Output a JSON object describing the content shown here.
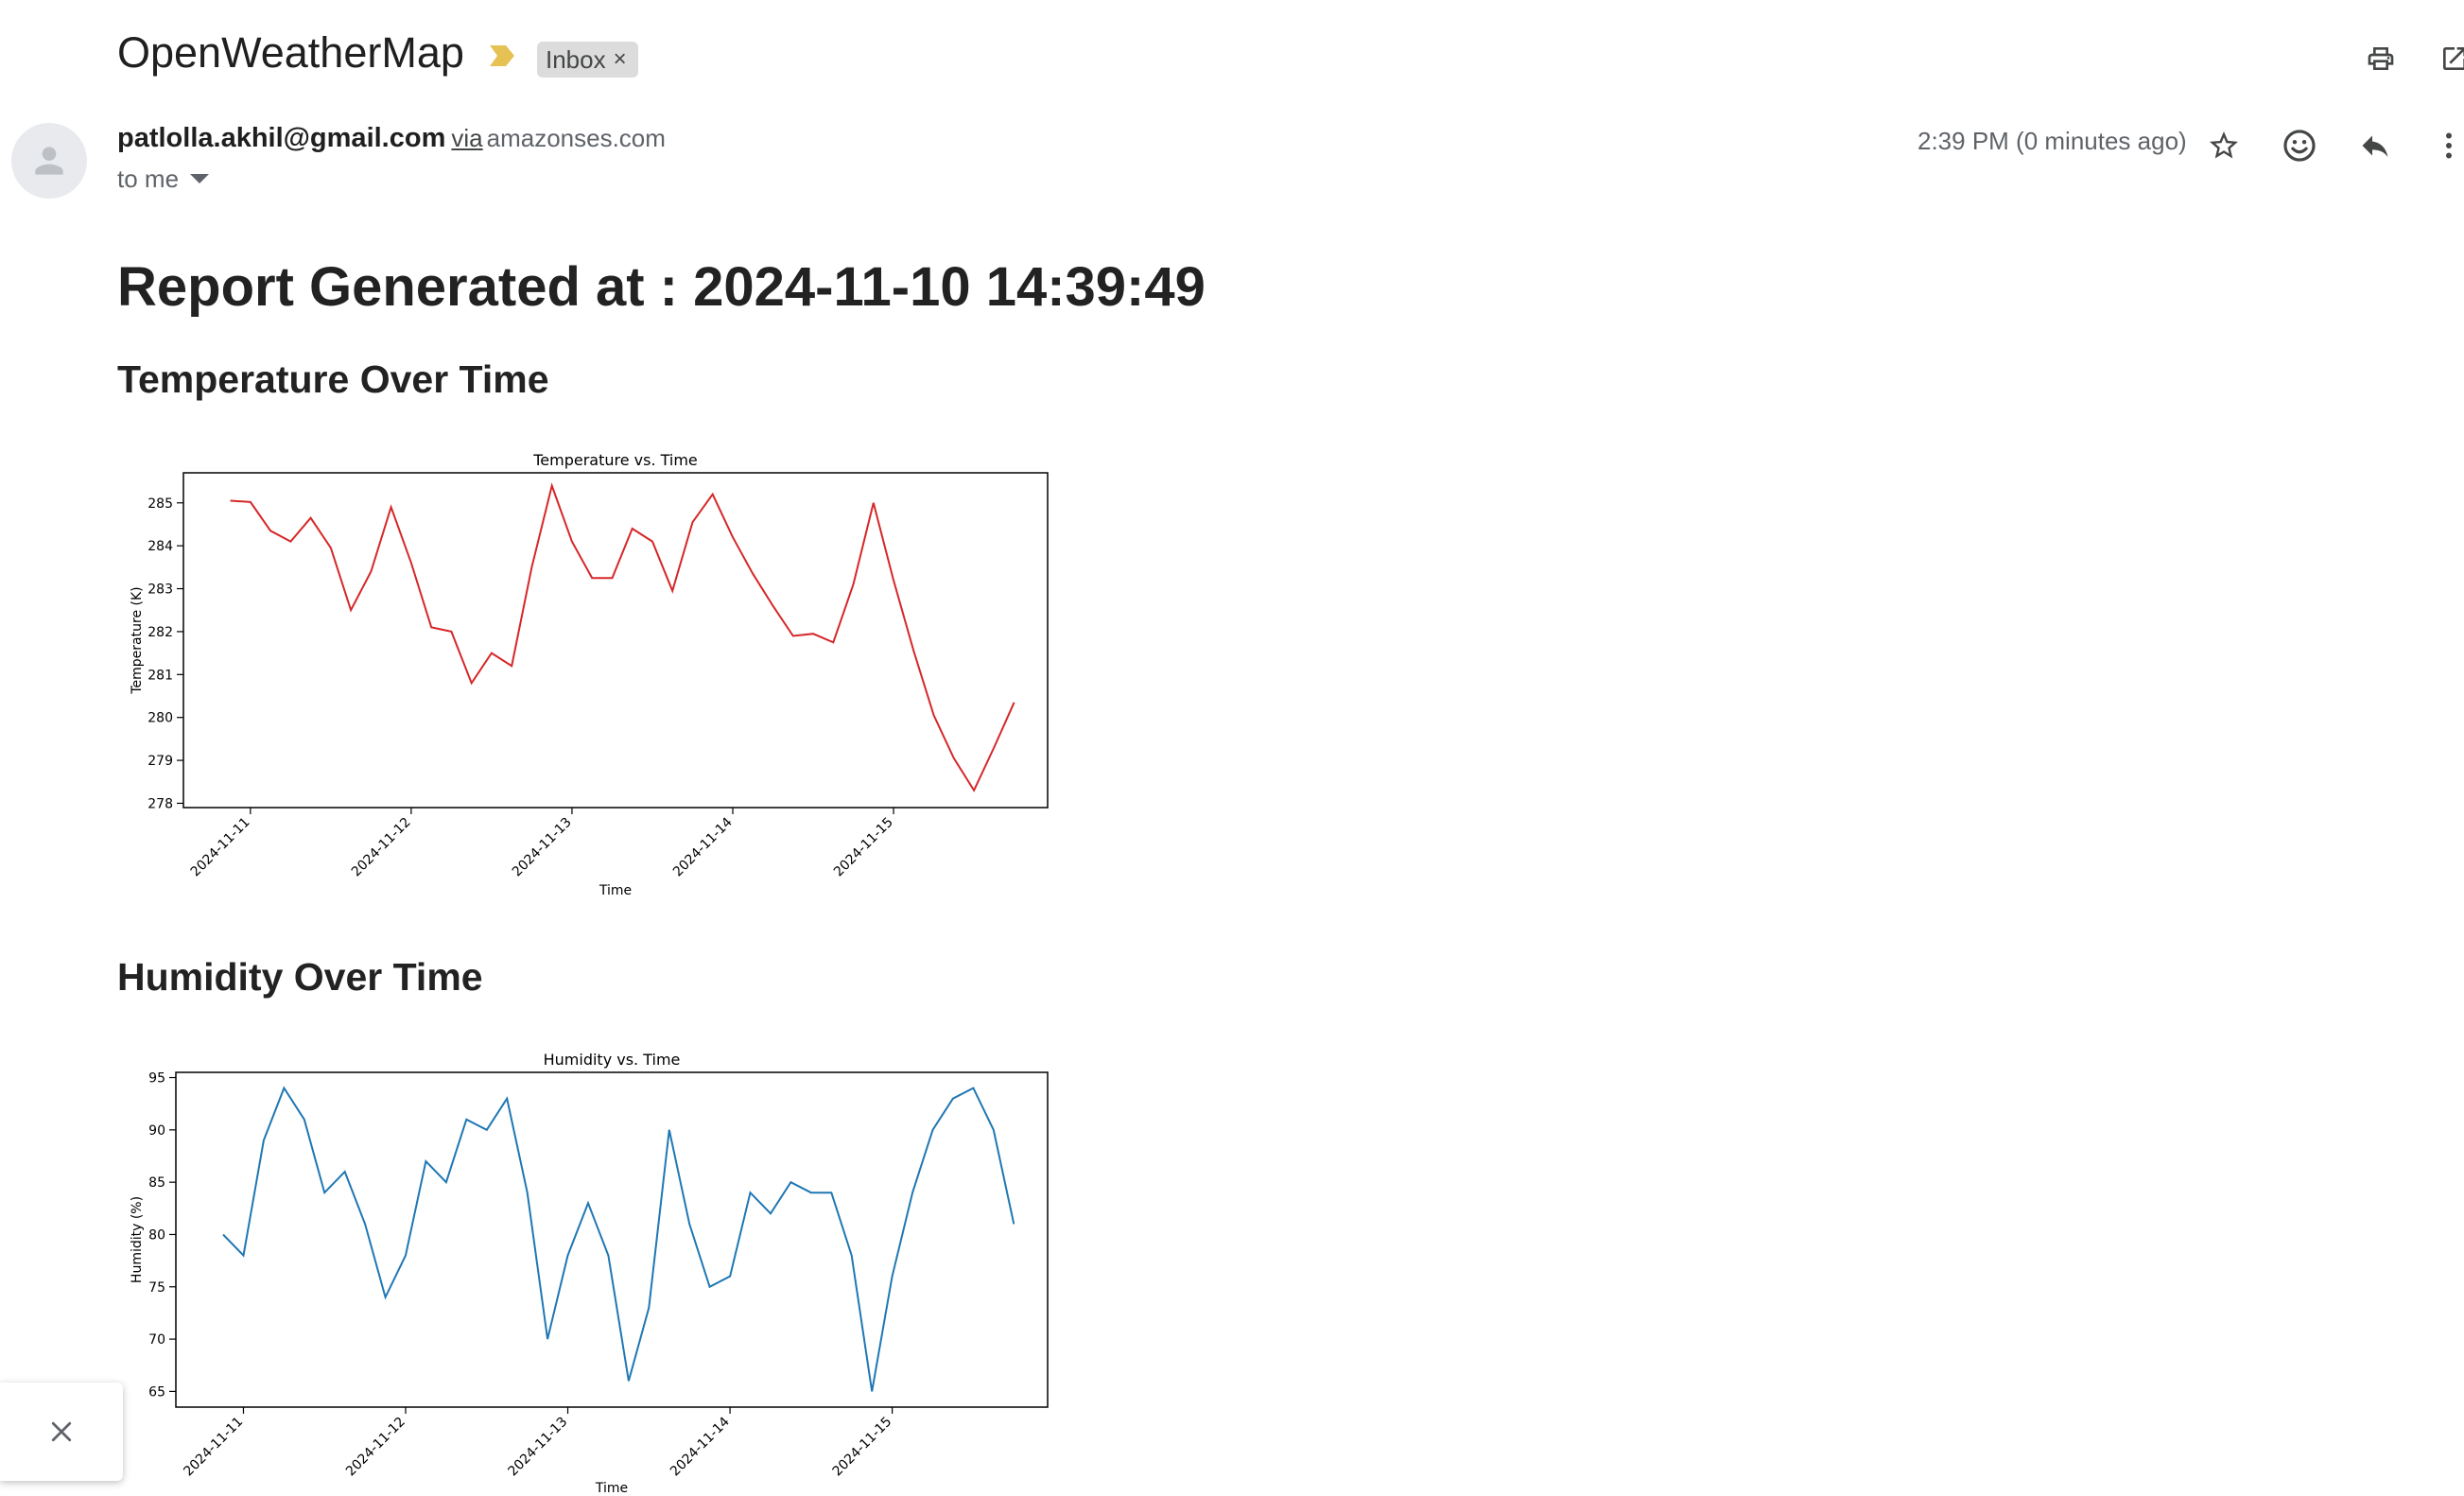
{
  "header": {
    "subject": "OpenWeatherMap",
    "label_chip": "Inbox",
    "icons": [
      "importance-marker-icon",
      "label-close-icon",
      "print-icon",
      "open-new-window-icon"
    ]
  },
  "message": {
    "sender_email": "patlolla.akhil@gmail.com",
    "via_text": "via",
    "via_domain": "amazonses.com",
    "recipient_text": "to me",
    "timestamp": "2:39 PM (0 minutes ago)",
    "action_icons": [
      "star-icon",
      "emoji-icon",
      "reply-icon",
      "more-vert-icon"
    ]
  },
  "body": {
    "report_title": "Report Generated at : 2024-11-10 14:39:49",
    "temperature_heading": "Temperature Over Time",
    "humidity_heading": "Humidity Over Time"
  },
  "colors": {
    "temperature_line": "#d62728",
    "humidity_line": "#1f77b4",
    "importance_marker": "#e6c255",
    "chip_bg": "#dcdcdc"
  },
  "chart_data": [
    {
      "type": "line",
      "title": "Temperature vs. Time",
      "xlabel": "Time",
      "ylabel": "Temperature (K)",
      "x_ticks": [
        "2024-11-11",
        "2024-11-12",
        "2024-11-13",
        "2024-11-14",
        "2024-11-15"
      ],
      "y_ticks": [
        278,
        279,
        280,
        281,
        282,
        283,
        284,
        285
      ],
      "xlim": [
        "2024-11-10 14:00",
        "2024-11-15 23:00"
      ],
      "ylim": [
        277.9,
        285.7
      ],
      "grid": false,
      "series": [
        {
          "x": [
            "2024-11-10 21:00",
            "2024-11-11 00:00",
            "2024-11-11 03:00",
            "2024-11-11 06:00",
            "2024-11-11 09:00",
            "2024-11-11 12:00",
            "2024-11-11 15:00",
            "2024-11-11 18:00",
            "2024-11-11 21:00",
            "2024-11-12 00:00",
            "2024-11-12 03:00",
            "2024-11-12 06:00",
            "2024-11-12 09:00",
            "2024-11-12 12:00",
            "2024-11-12 15:00",
            "2024-11-12 18:00",
            "2024-11-12 21:00",
            "2024-11-13 00:00",
            "2024-11-13 03:00",
            "2024-11-13 06:00",
            "2024-11-13 09:00",
            "2024-11-13 12:00",
            "2024-11-13 15:00",
            "2024-11-13 18:00",
            "2024-11-13 21:00",
            "2024-11-14 00:00",
            "2024-11-14 03:00",
            "2024-11-14 06:00",
            "2024-11-14 09:00",
            "2024-11-14 12:00",
            "2024-11-14 15:00",
            "2024-11-14 18:00",
            "2024-11-14 21:00",
            "2024-11-15 00:00",
            "2024-11-15 03:00",
            "2024-11-15 06:00",
            "2024-11-15 09:00",
            "2024-11-15 12:00",
            "2024-11-15 15:00",
            "2024-11-15 18:00"
          ],
          "values": [
            285.05,
            285.02,
            284.35,
            284.1,
            284.65,
            283.95,
            282.5,
            283.4,
            284.9,
            283.6,
            282.1,
            282.0,
            280.8,
            281.5,
            281.2,
            283.5,
            285.4,
            284.1,
            283.25,
            283.25,
            284.4,
            284.1,
            282.95,
            284.55,
            285.2,
            284.2,
            283.35,
            282.6,
            281.9,
            281.95,
            281.75,
            283.1,
            285.0,
            283.2,
            281.55,
            280.05,
            279.05,
            278.3,
            279.3,
            280.35
          ]
        }
      ]
    },
    {
      "type": "line",
      "title": "Humidity vs. Time",
      "xlabel": "Time",
      "ylabel": "Humidity (%)",
      "x_ticks": [
        "2024-11-11",
        "2024-11-12",
        "2024-11-13",
        "2024-11-14",
        "2024-11-15"
      ],
      "y_ticks": [
        65,
        70,
        75,
        80,
        85,
        90,
        95
      ],
      "xlim": [
        "2024-11-10 14:00",
        "2024-11-15 23:00"
      ],
      "ylim": [
        63.5,
        95.5
      ],
      "grid": false,
      "series": [
        {
          "x": [
            "2024-11-10 21:00",
            "2024-11-11 00:00",
            "2024-11-11 03:00",
            "2024-11-11 06:00",
            "2024-11-11 09:00",
            "2024-11-11 12:00",
            "2024-11-11 15:00",
            "2024-11-11 18:00",
            "2024-11-11 21:00",
            "2024-11-12 00:00",
            "2024-11-12 03:00",
            "2024-11-12 06:00",
            "2024-11-12 09:00",
            "2024-11-12 12:00",
            "2024-11-12 15:00",
            "2024-11-12 18:00",
            "2024-11-12 21:00",
            "2024-11-13 00:00",
            "2024-11-13 03:00",
            "2024-11-13 06:00",
            "2024-11-13 09:00",
            "2024-11-13 12:00",
            "2024-11-13 15:00",
            "2024-11-13 18:00",
            "2024-11-13 21:00",
            "2024-11-14 00:00",
            "2024-11-14 03:00",
            "2024-11-14 06:00",
            "2024-11-14 09:00",
            "2024-11-14 12:00",
            "2024-11-14 15:00",
            "2024-11-14 18:00",
            "2024-11-14 21:00",
            "2024-11-15 00:00",
            "2024-11-15 03:00",
            "2024-11-15 06:00",
            "2024-11-15 09:00",
            "2024-11-15 12:00",
            "2024-11-15 15:00",
            "2024-11-15 18:00"
          ],
          "values": [
            80,
            78,
            89,
            94,
            91,
            84,
            86,
            81,
            74,
            78,
            87,
            85,
            91,
            90,
            93,
            84,
            70,
            78,
            83,
            78,
            66,
            73,
            90,
            81,
            75,
            76,
            84,
            82,
            85,
            84,
            84,
            78,
            65,
            76,
            84,
            90,
            93,
            94,
            90,
            81
          ]
        }
      ]
    }
  ]
}
